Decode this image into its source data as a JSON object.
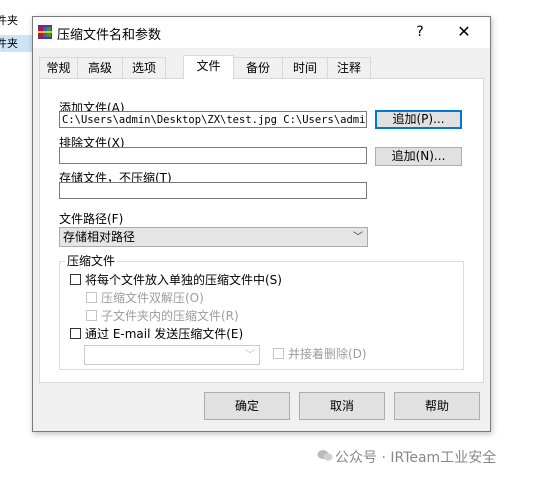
{
  "background": {
    "rows": [
      "件夹",
      "件夹"
    ]
  },
  "window": {
    "title": "压缩文件名和参数",
    "help_button": "?",
    "close_button": "✕"
  },
  "tabs": [
    {
      "label": "常规"
    },
    {
      "label": "高级"
    },
    {
      "label": "选项"
    },
    {
      "label": "文件",
      "active": true
    },
    {
      "label": "备份"
    },
    {
      "label": "时间"
    },
    {
      "label": "注释"
    }
  ],
  "files_tab": {
    "add_files_label": "添加文件(A)",
    "add_files_value": "C:\\Users\\admin\\Desktop\\ZX\\test.jpg C:\\Users\\admin\\D",
    "add_button": "追加(P)...",
    "exclude_files_label": "排除文件(X)",
    "exclude_files_value": "",
    "exclude_add_button": "追加(N)...",
    "store_files_label": "存储文件，不压缩(T)",
    "store_files_value": "",
    "file_paths_label": "文件路径(F)",
    "file_paths_value": "存储相对路径",
    "archive_group_title": "压缩文件",
    "options": {
      "separate": "将每个文件放入单独的压缩文件中(S)",
      "double_extract": "压缩文件双解压(O)",
      "subfolder": "子文件夹内的压缩文件(R)",
      "email": "通过 E-mail 发送压缩文件(E)",
      "delete_after": "并接着删除(D)"
    }
  },
  "footer": {
    "ok": "确定",
    "cancel": "取消",
    "help": "帮助"
  },
  "watermark": "公众号 · IRTeam工业安全"
}
